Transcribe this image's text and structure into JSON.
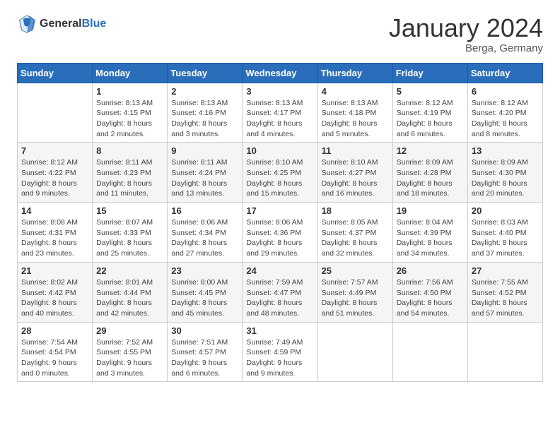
{
  "header": {
    "logo_general": "General",
    "logo_blue": "Blue",
    "month_title": "January 2024",
    "location": "Berga, Germany"
  },
  "days_of_week": [
    "Sunday",
    "Monday",
    "Tuesday",
    "Wednesday",
    "Thursday",
    "Friday",
    "Saturday"
  ],
  "weeks": [
    [
      {
        "day": "",
        "sunrise": "",
        "sunset": "",
        "daylight": ""
      },
      {
        "day": "1",
        "sunrise": "Sunrise: 8:13 AM",
        "sunset": "Sunset: 4:15 PM",
        "daylight": "Daylight: 8 hours and 2 minutes."
      },
      {
        "day": "2",
        "sunrise": "Sunrise: 8:13 AM",
        "sunset": "Sunset: 4:16 PM",
        "daylight": "Daylight: 8 hours and 3 minutes."
      },
      {
        "day": "3",
        "sunrise": "Sunrise: 8:13 AM",
        "sunset": "Sunset: 4:17 PM",
        "daylight": "Daylight: 8 hours and 4 minutes."
      },
      {
        "day": "4",
        "sunrise": "Sunrise: 8:13 AM",
        "sunset": "Sunset: 4:18 PM",
        "daylight": "Daylight: 8 hours and 5 minutes."
      },
      {
        "day": "5",
        "sunrise": "Sunrise: 8:12 AM",
        "sunset": "Sunset: 4:19 PM",
        "daylight": "Daylight: 8 hours and 6 minutes."
      },
      {
        "day": "6",
        "sunrise": "Sunrise: 8:12 AM",
        "sunset": "Sunset: 4:20 PM",
        "daylight": "Daylight: 8 hours and 8 minutes."
      }
    ],
    [
      {
        "day": "7",
        "sunrise": "Sunrise: 8:12 AM",
        "sunset": "Sunset: 4:22 PM",
        "daylight": "Daylight: 8 hours and 9 minutes."
      },
      {
        "day": "8",
        "sunrise": "Sunrise: 8:11 AM",
        "sunset": "Sunset: 4:23 PM",
        "daylight": "Daylight: 8 hours and 11 minutes."
      },
      {
        "day": "9",
        "sunrise": "Sunrise: 8:11 AM",
        "sunset": "Sunset: 4:24 PM",
        "daylight": "Daylight: 8 hours and 13 minutes."
      },
      {
        "day": "10",
        "sunrise": "Sunrise: 8:10 AM",
        "sunset": "Sunset: 4:25 PM",
        "daylight": "Daylight: 8 hours and 15 minutes."
      },
      {
        "day": "11",
        "sunrise": "Sunrise: 8:10 AM",
        "sunset": "Sunset: 4:27 PM",
        "daylight": "Daylight: 8 hours and 16 minutes."
      },
      {
        "day": "12",
        "sunrise": "Sunrise: 8:09 AM",
        "sunset": "Sunset: 4:28 PM",
        "daylight": "Daylight: 8 hours and 18 minutes."
      },
      {
        "day": "13",
        "sunrise": "Sunrise: 8:09 AM",
        "sunset": "Sunset: 4:30 PM",
        "daylight": "Daylight: 8 hours and 20 minutes."
      }
    ],
    [
      {
        "day": "14",
        "sunrise": "Sunrise: 8:08 AM",
        "sunset": "Sunset: 4:31 PM",
        "daylight": "Daylight: 8 hours and 23 minutes."
      },
      {
        "day": "15",
        "sunrise": "Sunrise: 8:07 AM",
        "sunset": "Sunset: 4:33 PM",
        "daylight": "Daylight: 8 hours and 25 minutes."
      },
      {
        "day": "16",
        "sunrise": "Sunrise: 8:06 AM",
        "sunset": "Sunset: 4:34 PM",
        "daylight": "Daylight: 8 hours and 27 minutes."
      },
      {
        "day": "17",
        "sunrise": "Sunrise: 8:06 AM",
        "sunset": "Sunset: 4:36 PM",
        "daylight": "Daylight: 8 hours and 29 minutes."
      },
      {
        "day": "18",
        "sunrise": "Sunrise: 8:05 AM",
        "sunset": "Sunset: 4:37 PM",
        "daylight": "Daylight: 8 hours and 32 minutes."
      },
      {
        "day": "19",
        "sunrise": "Sunrise: 8:04 AM",
        "sunset": "Sunset: 4:39 PM",
        "daylight": "Daylight: 8 hours and 34 minutes."
      },
      {
        "day": "20",
        "sunrise": "Sunrise: 8:03 AM",
        "sunset": "Sunset: 4:40 PM",
        "daylight": "Daylight: 8 hours and 37 minutes."
      }
    ],
    [
      {
        "day": "21",
        "sunrise": "Sunrise: 8:02 AM",
        "sunset": "Sunset: 4:42 PM",
        "daylight": "Daylight: 8 hours and 40 minutes."
      },
      {
        "day": "22",
        "sunrise": "Sunrise: 8:01 AM",
        "sunset": "Sunset: 4:44 PM",
        "daylight": "Daylight: 8 hours and 42 minutes."
      },
      {
        "day": "23",
        "sunrise": "Sunrise: 8:00 AM",
        "sunset": "Sunset: 4:45 PM",
        "daylight": "Daylight: 8 hours and 45 minutes."
      },
      {
        "day": "24",
        "sunrise": "Sunrise: 7:59 AM",
        "sunset": "Sunset: 4:47 PM",
        "daylight": "Daylight: 8 hours and 48 minutes."
      },
      {
        "day": "25",
        "sunrise": "Sunrise: 7:57 AM",
        "sunset": "Sunset: 4:49 PM",
        "daylight": "Daylight: 8 hours and 51 minutes."
      },
      {
        "day": "26",
        "sunrise": "Sunrise: 7:56 AM",
        "sunset": "Sunset: 4:50 PM",
        "daylight": "Daylight: 8 hours and 54 minutes."
      },
      {
        "day": "27",
        "sunrise": "Sunrise: 7:55 AM",
        "sunset": "Sunset: 4:52 PM",
        "daylight": "Daylight: 8 hours and 57 minutes."
      }
    ],
    [
      {
        "day": "28",
        "sunrise": "Sunrise: 7:54 AM",
        "sunset": "Sunset: 4:54 PM",
        "daylight": "Daylight: 9 hours and 0 minutes."
      },
      {
        "day": "29",
        "sunrise": "Sunrise: 7:52 AM",
        "sunset": "Sunset: 4:55 PM",
        "daylight": "Daylight: 9 hours and 3 minutes."
      },
      {
        "day": "30",
        "sunrise": "Sunrise: 7:51 AM",
        "sunset": "Sunset: 4:57 PM",
        "daylight": "Daylight: 9 hours and 6 minutes."
      },
      {
        "day": "31",
        "sunrise": "Sunrise: 7:49 AM",
        "sunset": "Sunset: 4:59 PM",
        "daylight": "Daylight: 9 hours and 9 minutes."
      },
      {
        "day": "",
        "sunrise": "",
        "sunset": "",
        "daylight": ""
      },
      {
        "day": "",
        "sunrise": "",
        "sunset": "",
        "daylight": ""
      },
      {
        "day": "",
        "sunrise": "",
        "sunset": "",
        "daylight": ""
      }
    ]
  ]
}
